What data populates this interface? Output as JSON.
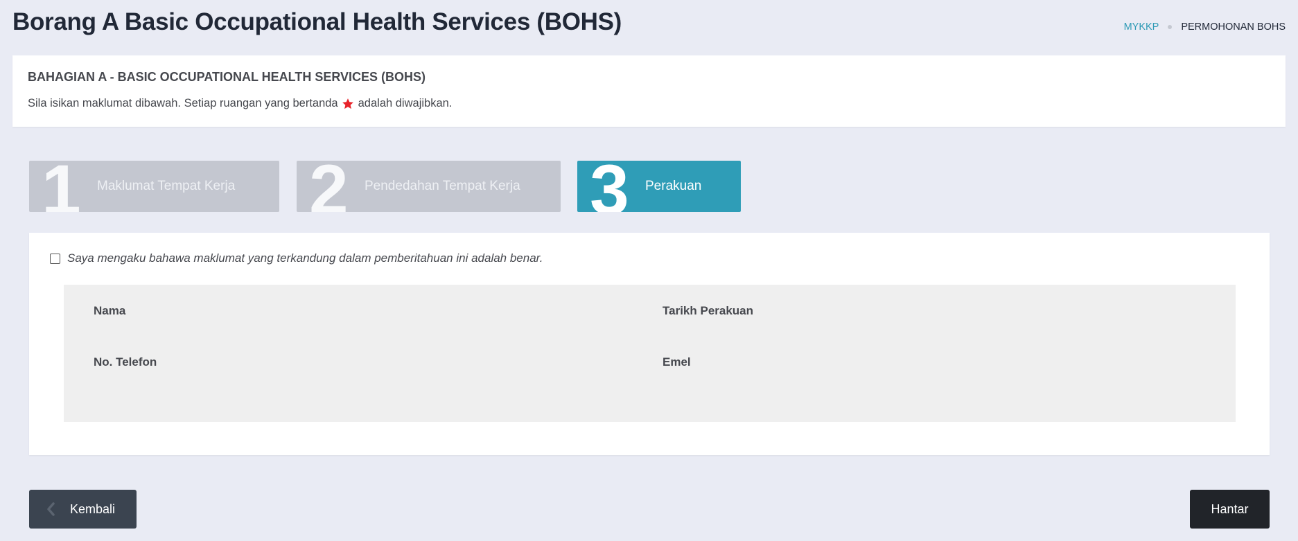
{
  "header": {
    "title": "Borang A Basic Occupational Health Services (BOHS)",
    "breadcrumb": {
      "home": "MYKKP",
      "current": "PERMOHONAN BOHS"
    }
  },
  "intro": {
    "heading": "BAHAGIAN A - BASIC OCCUPATIONAL HEALTH SERVICES (BOHS)",
    "text_before": "Sila isikan maklumat dibawah. Setiap ruangan yang bertanda",
    "text_after": "adalah diwajibkan.",
    "required_icon": "star-icon",
    "required_color": "#e8232a"
  },
  "steps": [
    {
      "number": "1",
      "label": "Maklumat Tempat Kerja",
      "active": false
    },
    {
      "number": "2",
      "label": "Pendedahan Tempat Kerja",
      "active": false
    },
    {
      "number": "3",
      "label": "Perakuan",
      "active": true
    }
  ],
  "declaration": {
    "checked": false,
    "text": "Saya mengaku bahawa maklumat yang terkandung dalam pemberitahuan ini adalah benar."
  },
  "fields": {
    "nama": "Nama",
    "tarikh": "Tarikh Perakuan",
    "telefon": "No. Telefon",
    "emel": "Emel"
  },
  "buttons": {
    "back": "Kembali",
    "submit": "Hantar"
  },
  "colors": {
    "accent": "#2f9db7",
    "step_inactive": "#c4c7d0",
    "background": "#e9ebf4"
  }
}
